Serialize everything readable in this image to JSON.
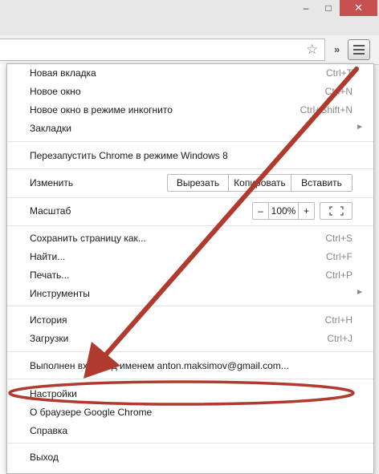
{
  "window": {
    "minimize_glyph": "–",
    "maximize_glyph": "□",
    "close_glyph": "✕"
  },
  "toolbar": {
    "star_glyph": "☆",
    "overflow_glyph": "»"
  },
  "menu": {
    "new_tab": {
      "label": "Новая вкладка",
      "shortcut": "Ctrl+T"
    },
    "new_window": {
      "label": "Новое окно",
      "shortcut": "Ctrl+N"
    },
    "incognito": {
      "label": "Новое окно в режиме инкогнито",
      "shortcut": "Ctrl+Shift+N"
    },
    "bookmarks": {
      "label": "Закладки"
    },
    "relaunch_win8": {
      "label": "Перезапустить Chrome в режиме Windows 8"
    },
    "edit": {
      "label": "Изменить",
      "cut": "Вырезать",
      "copy": "Копировать",
      "paste": "Вставить"
    },
    "zoom": {
      "label": "Масштаб",
      "minus": "–",
      "value": "100%",
      "plus": "+"
    },
    "save_page": {
      "label": "Сохранить страницу как...",
      "shortcut": "Ctrl+S"
    },
    "find": {
      "label": "Найти...",
      "shortcut": "Ctrl+F"
    },
    "print": {
      "label": "Печать...",
      "shortcut": "Ctrl+P"
    },
    "tools": {
      "label": "Инструменты"
    },
    "history": {
      "label": "История",
      "shortcut": "Ctrl+H"
    },
    "downloads": {
      "label": "Загрузки",
      "shortcut": "Ctrl+J"
    },
    "signed_in": {
      "label": "Выполнен вход под именем anton.maksimov@gmail.com..."
    },
    "settings": {
      "label": "Настройки"
    },
    "about": {
      "label": "О браузере Google Chrome"
    },
    "help": {
      "label": "Справка"
    },
    "exit": {
      "label": "Выход"
    },
    "submenu_glyph": "►"
  },
  "colors": {
    "annotation": "#c0392b",
    "close_button": "#c75050"
  }
}
